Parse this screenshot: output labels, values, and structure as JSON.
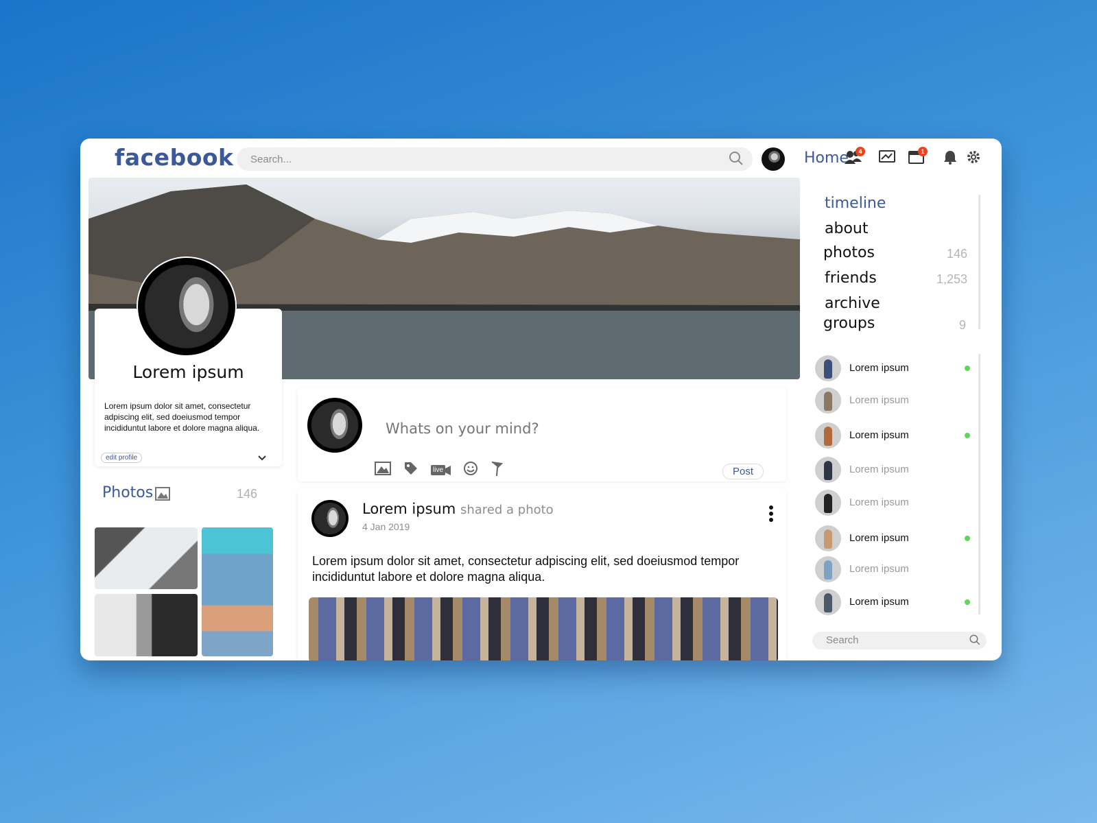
{
  "header": {
    "logo": "facebook",
    "search_placeholder": "Search...",
    "home_label": "Home",
    "friends_badge": "4",
    "events_badge": "1"
  },
  "profile": {
    "name": "Lorem ipsum",
    "bio": "Lorem ipsum dolor sit amet, consectetur adpiscing elit, sed doeiusmod tempor incididuntut labore et dolore magna aliqua.",
    "edit_label": "edit profile"
  },
  "photos": {
    "title": "Photos",
    "count": "146"
  },
  "composer": {
    "placeholder": "Whats on your mind?",
    "live_label": "live",
    "post_label": "Post"
  },
  "post": {
    "author": "Lorem ipsum",
    "action": "shared a photo",
    "date": "4 Jan 2019",
    "text": "Lorem ipsum dolor sit amet, consectetur adpiscing elit, sed doeiusmod tempor incididuntut labore et dolore magna aliqua."
  },
  "nav": {
    "items": [
      {
        "label": "timeline",
        "count": ""
      },
      {
        "label": "about",
        "count": ""
      },
      {
        "label": "photos",
        "count": "146"
      },
      {
        "label": "friends",
        "count": "1,253"
      },
      {
        "label": "archive",
        "count": ""
      },
      {
        "label": "groups",
        "count": "9"
      }
    ]
  },
  "contacts": {
    "items": [
      {
        "name": "Lorem ipsum",
        "online": true
      },
      {
        "name": "Lorem ipsum",
        "online": false
      },
      {
        "name": "Lorem ipsum",
        "online": true
      },
      {
        "name": "Lorem ipsum",
        "online": false
      },
      {
        "name": "Lorem ipsum",
        "online": false
      },
      {
        "name": "Lorem ipsum",
        "online": true
      },
      {
        "name": "Lorem ipsum",
        "online": false
      },
      {
        "name": "Lorem ipsum",
        "online": true
      }
    ],
    "search_placeholder": "Search"
  },
  "colors": {
    "brand": "#3b5998",
    "badge": "#e8451e",
    "online": "#5ed65b"
  }
}
